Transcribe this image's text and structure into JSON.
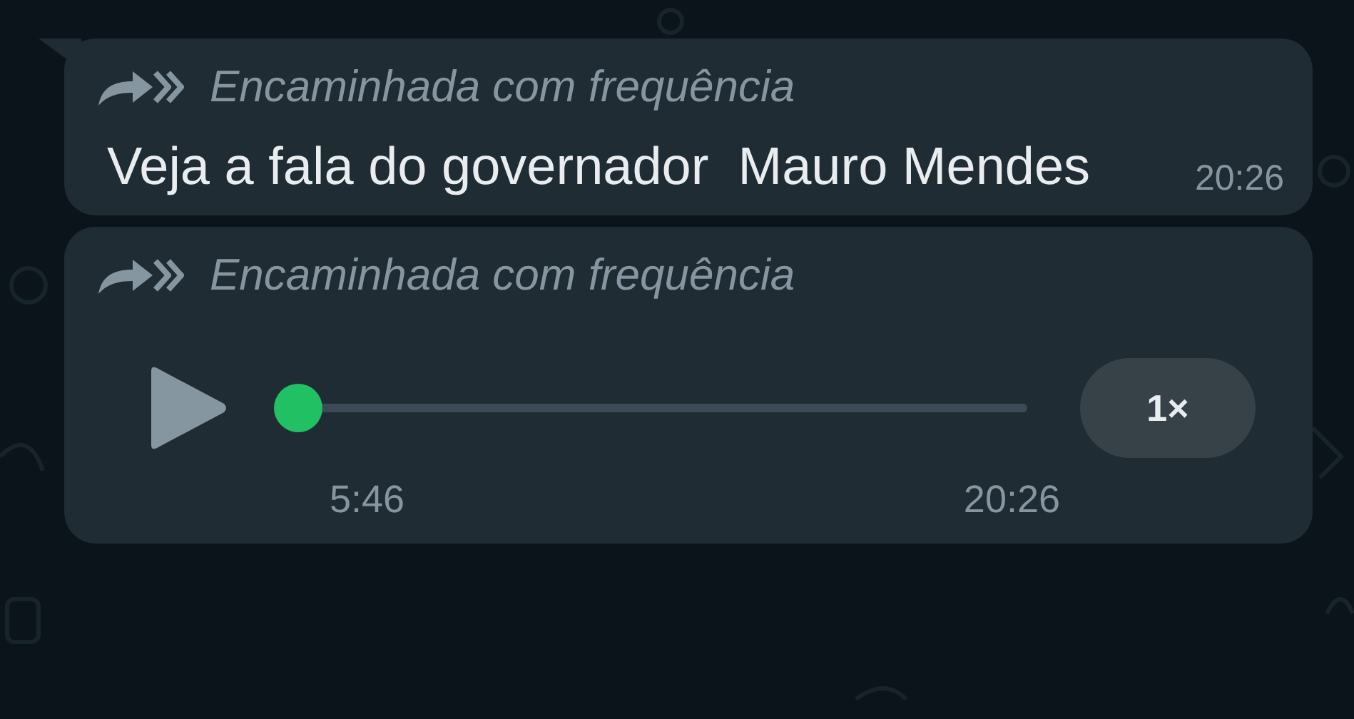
{
  "messages": [
    {
      "kind": "text",
      "forwarded_label": "Encaminhada com frequência",
      "text": "Veja a fala do governador  Mauro Mendes",
      "time": "20:26"
    },
    {
      "kind": "audio",
      "forwarded_label": "Encaminhada com frequência",
      "level": 0,
      "duration": "5:46",
      "time": "20:26",
      "speed": "1×"
    }
  ]
}
